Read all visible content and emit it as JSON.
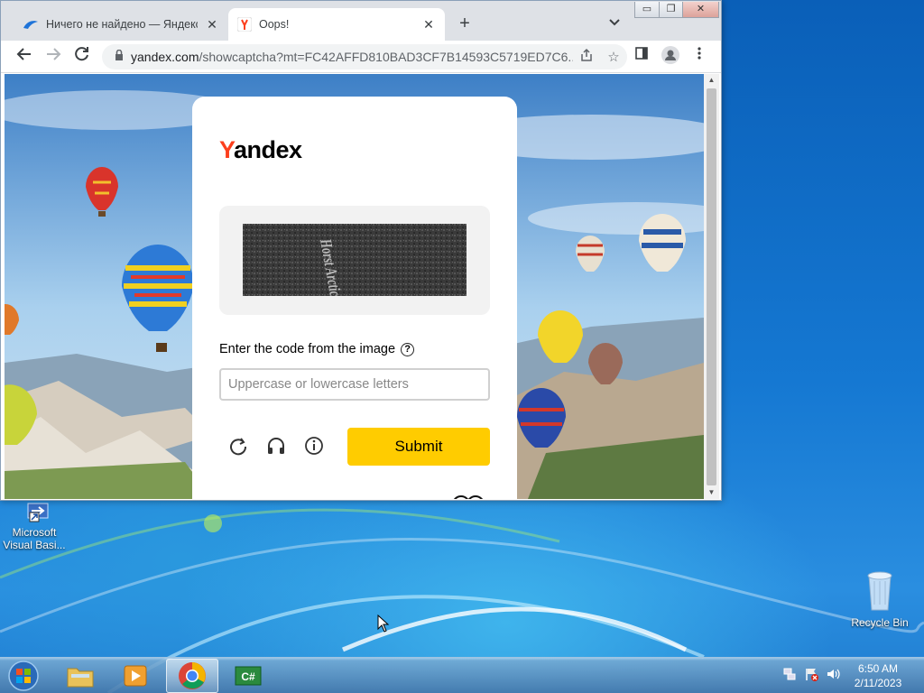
{
  "browser": {
    "tabs": [
      {
        "title": "Ничего не найдено — Яндекс.Д",
        "icon": "dolphin-favicon-icon",
        "active": false
      },
      {
        "title": "Oops!",
        "icon": "yandex-y-favicon-icon",
        "active": true
      }
    ],
    "new_tab": "+",
    "tab_search": "⌄",
    "url_host": "yandex.com",
    "url_rest": "/showcaptcha?mt=FC42AFFD810BAD3CF7B14593C5719ED7C6..."
  },
  "captcha_page": {
    "logo_y": "Y",
    "logo_rest": "andex",
    "captcha_text": "Horst Arctic",
    "prompt": "Enter the code from the image",
    "input_placeholder": "Uppercase or lowercase letters",
    "input_value": "",
    "submit_label": "Submit"
  },
  "desktop": {
    "icons": [
      {
        "label_line1": "Microsoft",
        "label_line2": "Visual Basi..."
      },
      {
        "label_line1": "Recycle Bin",
        "label_line2": ""
      }
    ]
  },
  "taskbar": {
    "clock_time": "6:50 AM",
    "clock_date": "2/11/2023"
  },
  "colors": {
    "yandex_red": "#fc3f1d",
    "submit_yellow": "#ffcc00",
    "tab_strip": "#dee1e6"
  }
}
